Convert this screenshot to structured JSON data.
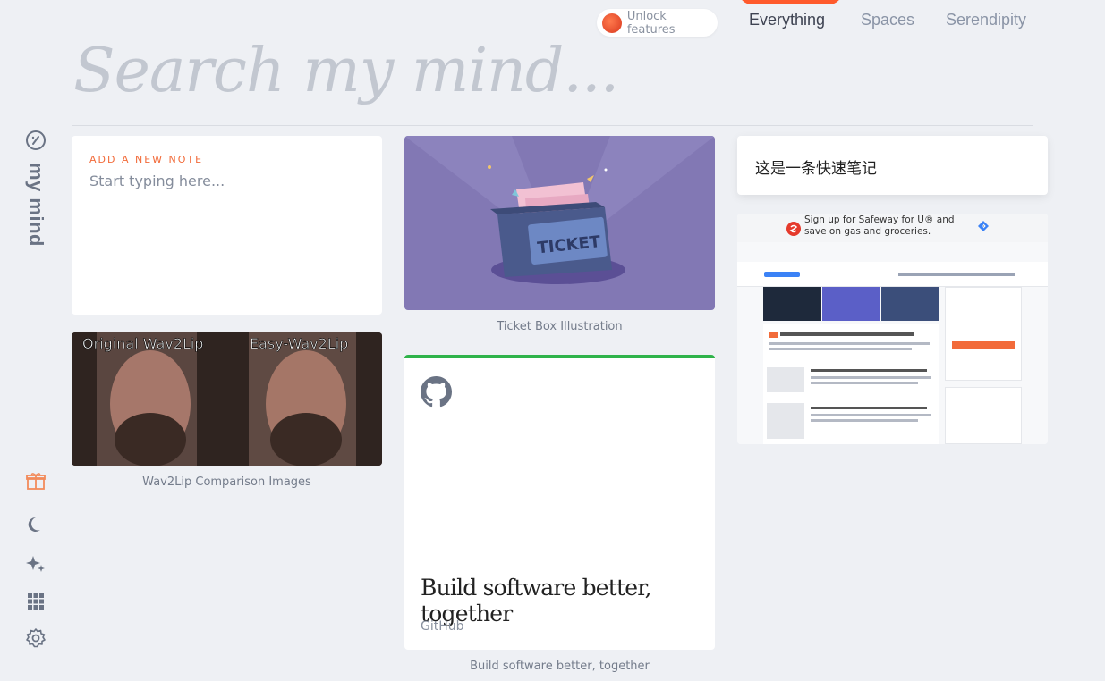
{
  "header": {
    "unlock_label": "Unlock features",
    "tabs": [
      {
        "label": "Everything",
        "active": true
      },
      {
        "label": "Spaces",
        "active": false
      },
      {
        "label": "Serendipity",
        "active": false
      }
    ]
  },
  "search": {
    "placeholder": "Search my mind..."
  },
  "sidebar": {
    "brand": "my mind",
    "icons": [
      "gift-icon",
      "moon-icon",
      "sparkles-icon",
      "grid-icon",
      "gear-icon"
    ]
  },
  "note": {
    "label": "ADD A NEW NOTE",
    "placeholder": "Start typing here..."
  },
  "cards": {
    "ticket": {
      "art_text": "TICKET",
      "caption": "Ticket Box Illustration"
    },
    "quick_note": {
      "text": "这是一条快速笔记"
    },
    "screenshot": {
      "ad_text": "Sign up for Safeway for U® and save on gas and groceries."
    },
    "wav2lip": {
      "left_label": "Original Wav2Lip",
      "right_label": "Easy-Wav2Lip",
      "caption": "Wav2Lip Comparison Images"
    },
    "github": {
      "title": "Build software better, together",
      "source": "GitHub",
      "caption": "Build software better, together"
    }
  },
  "colors": {
    "accent": "#ff5a2c",
    "github_bar": "#2fb34a",
    "ticket_bg": "#8278b4"
  }
}
